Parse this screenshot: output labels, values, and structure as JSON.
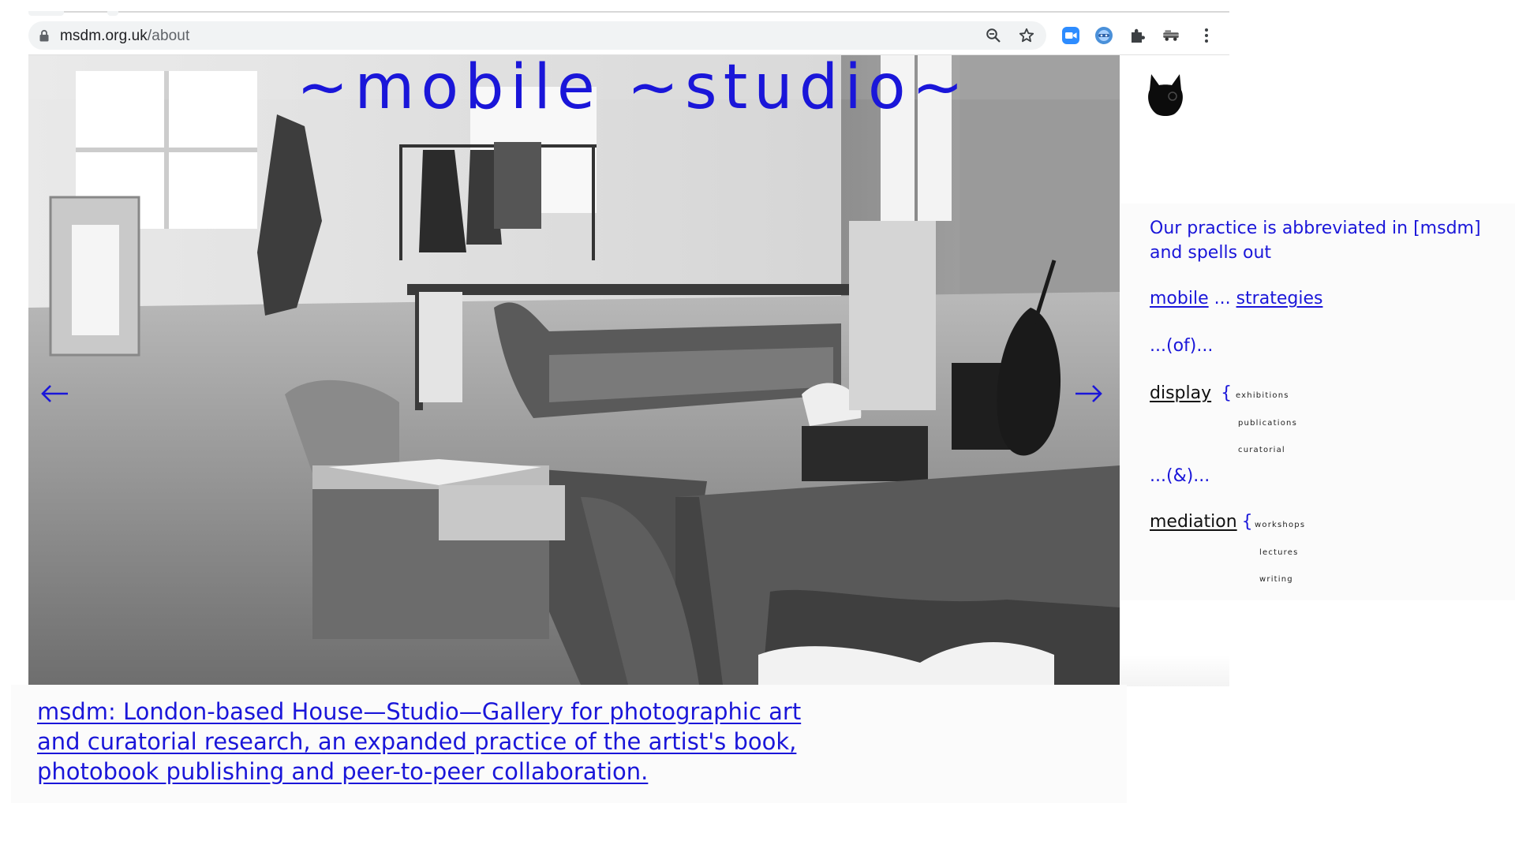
{
  "browser": {
    "url_domain": "msdm.org.uk",
    "url_path": "/about",
    "icons": [
      "lock-icon",
      "zoom-icon",
      "bookmark-star-icon",
      "zoom-video-extension-icon",
      "globe-extension-icon",
      "extensions-puzzle-icon",
      "vehicle-extension-icon",
      "menu-kebab-icon"
    ]
  },
  "hero": {
    "title": "~mobile ~studio~",
    "prev_arrow": "←",
    "next_arrow": "→"
  },
  "panel": {
    "intro": "Our practice is abbreviated in [msdm] and spells out",
    "line_mobile": "mobile",
    "line_mobile_sep": " ... ",
    "line_strategies": "strategies",
    "of": "...(of)...",
    "display": "display",
    "brace": "{",
    "display_items": [
      "exhibitions",
      "publications",
      "curatorial"
    ],
    "amp": "...(&)...",
    "mediation": "mediation",
    "mediation_items": [
      "workshops",
      "lectures",
      "writing"
    ]
  },
  "caption": {
    "text": "msdm: London-based House—Studio—Gallery for photographic art and curatorial research, an expanded practice of the artist's book, photobook publishing and peer-to-peer collaboration."
  },
  "colors": {
    "accent_blue": "#1a16d9",
    "panel_bg": "#fbfbfb",
    "omnibox_bg": "#f1f3f4"
  }
}
